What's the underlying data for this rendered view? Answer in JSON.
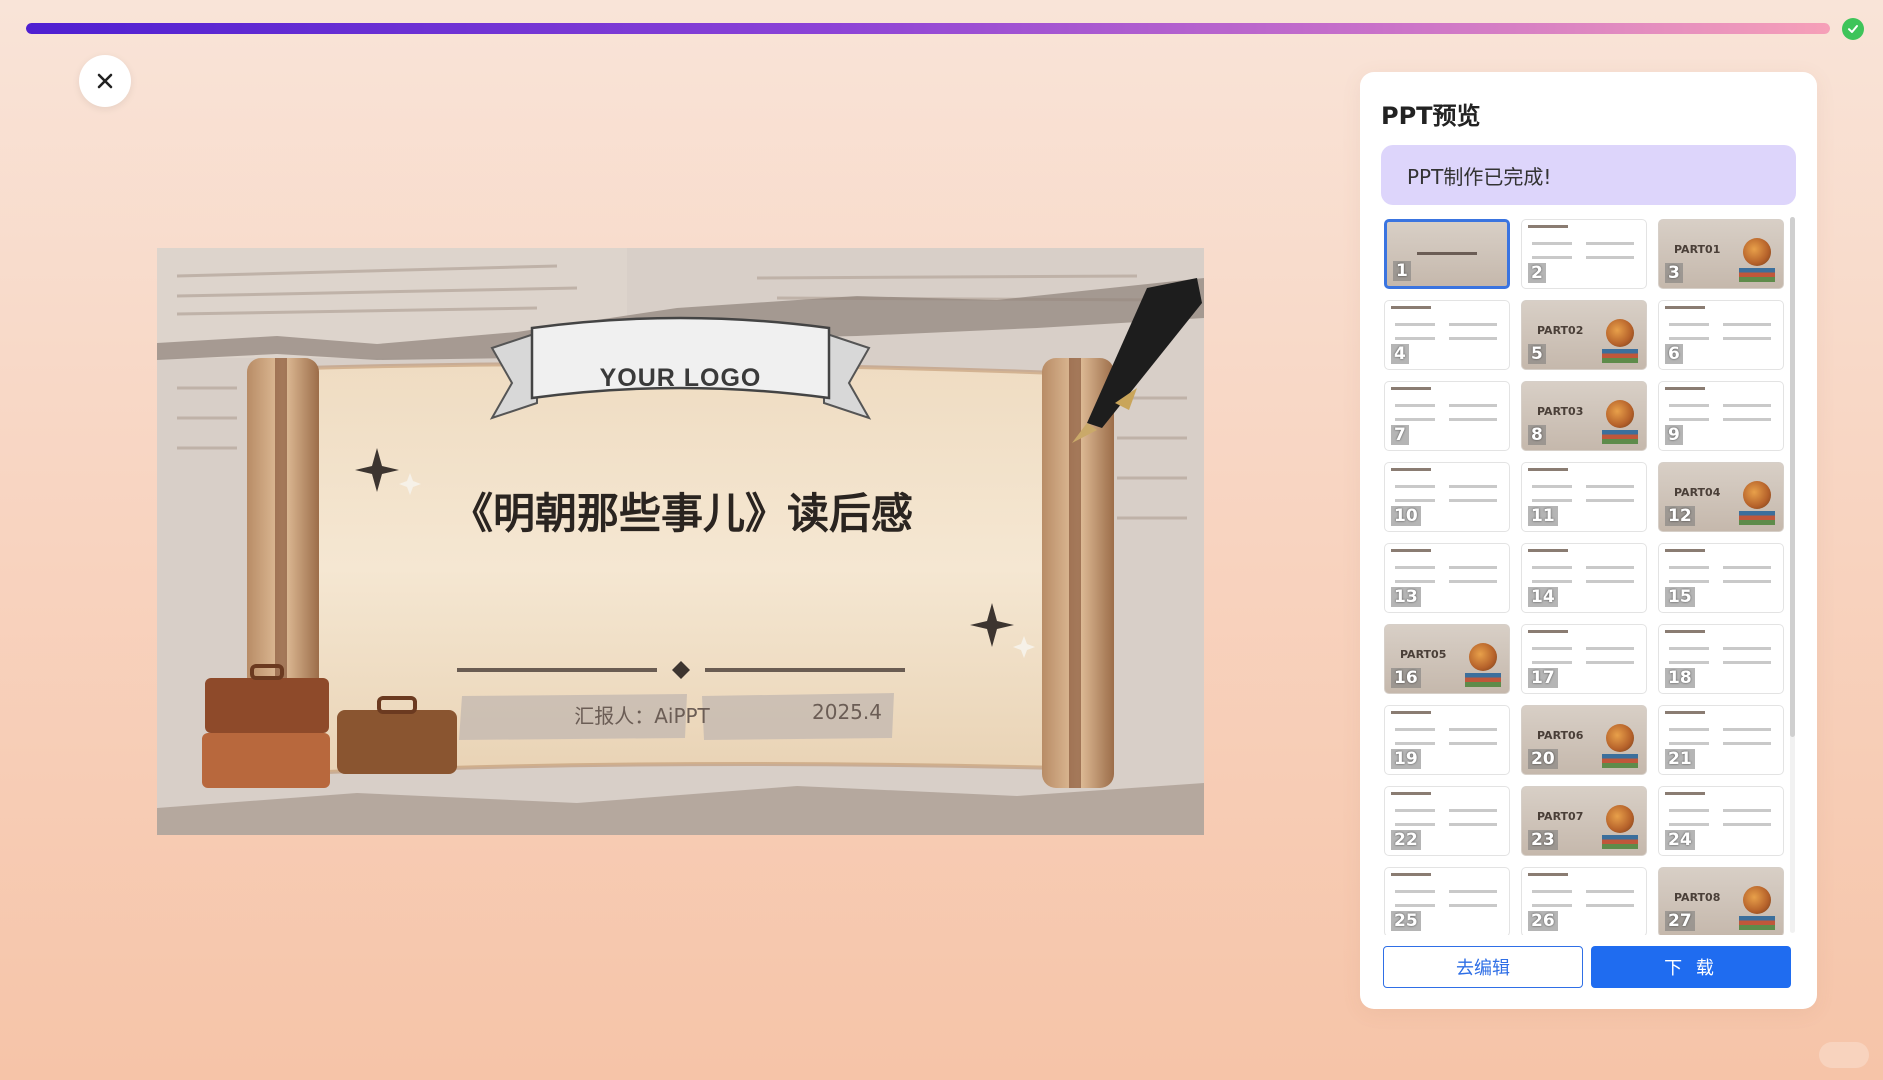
{
  "progress": {
    "fraction": 1.0,
    "gradient": [
      "#4f1fd1",
      "#8d43d6",
      "#c971c9",
      "#f6a0b8"
    ]
  },
  "status_icon": "check-circle-icon",
  "close_icon": "close-icon",
  "slide": {
    "logo_text": "YOUR LOGO",
    "title": "《明朝那些事儿》读后感",
    "presenter": "汇报人：AiPPT",
    "date": "2025.4"
  },
  "panel": {
    "title": "PPT预览",
    "status": "PPT制作已完成!",
    "edit_label": "去编辑",
    "download_label": "下 载",
    "selected_index": 0,
    "thumbnails": [
      {
        "num": "1",
        "style": "title"
      },
      {
        "num": "2",
        "style": "list"
      },
      {
        "num": "3",
        "style": "part",
        "part": "PART01"
      },
      {
        "num": "4",
        "style": "text"
      },
      {
        "num": "5",
        "style": "part",
        "part": "PART02"
      },
      {
        "num": "6",
        "style": "diamonds"
      },
      {
        "num": "7",
        "style": "wave"
      },
      {
        "num": "8",
        "style": "part",
        "part": "PART03"
      },
      {
        "num": "9",
        "style": "text"
      },
      {
        "num": "10",
        "style": "numbers"
      },
      {
        "num": "11",
        "style": "timeline"
      },
      {
        "num": "12",
        "style": "part",
        "part": "PART04"
      },
      {
        "num": "13",
        "style": "text"
      },
      {
        "num": "14",
        "style": "timeline"
      },
      {
        "num": "15",
        "style": "text"
      },
      {
        "num": "16",
        "style": "part",
        "part": "PART05"
      },
      {
        "num": "17",
        "style": "text"
      },
      {
        "num": "18",
        "style": "text"
      },
      {
        "num": "19",
        "style": "box"
      },
      {
        "num": "20",
        "style": "part",
        "part": "PART06"
      },
      {
        "num": "21",
        "style": "text"
      },
      {
        "num": "22",
        "style": "bar"
      },
      {
        "num": "23",
        "style": "part",
        "part": "PART07"
      },
      {
        "num": "24",
        "style": "diamonds"
      },
      {
        "num": "25",
        "style": "text"
      },
      {
        "num": "26",
        "style": "hex"
      },
      {
        "num": "27",
        "style": "part",
        "part": "PART08"
      }
    ]
  }
}
